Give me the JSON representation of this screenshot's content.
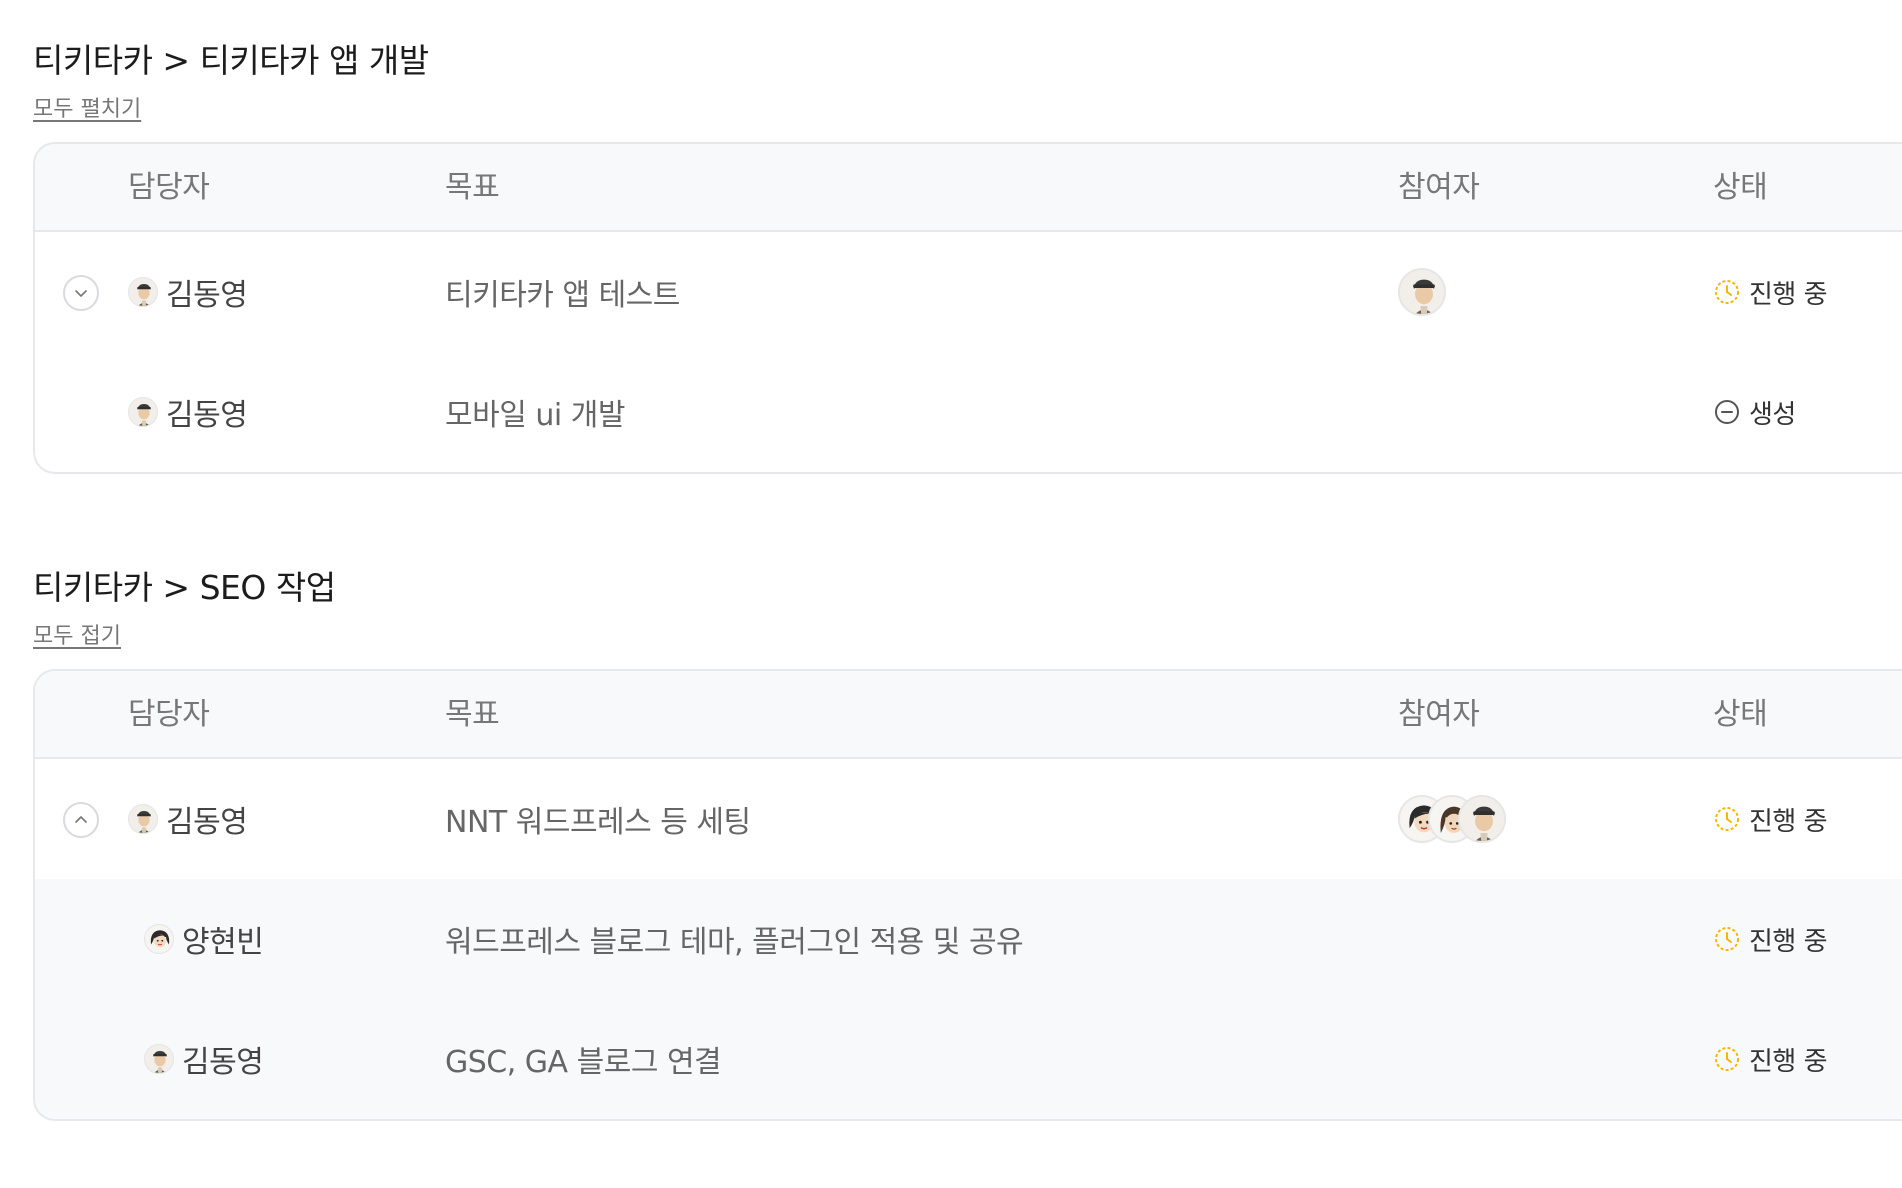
{
  "sections": [
    {
      "title": "티키타카 > 티키타카 앱 개발",
      "toggle_label": "모두 펼치기",
      "headers": {
        "owner": "담당자",
        "goal": "목표",
        "participants": "참여자",
        "status": "상태"
      },
      "rows": [
        {
          "owner": "김동영",
          "goal": "티키타카 앱  테스트",
          "status": "진행 중"
        },
        {
          "owner": "김동영",
          "goal": "모바일 ui 개발",
          "status": "생성"
        }
      ]
    },
    {
      "title": "티키타카 > SEO 작업",
      "toggle_label": "모두 접기",
      "headers": {
        "owner": "담당자",
        "goal": "목표",
        "participants": "참여자",
        "status": "상태"
      },
      "rows": [
        {
          "owner": "김동영",
          "goal": "NNT 워드프레스 등 세팅",
          "status": "진행 중"
        },
        {
          "owner": "양현빈",
          "goal": "워드프레스 블로그 테마, 플러그인 적용 및 공유",
          "status": "진행 중"
        },
        {
          "owner": "김동영",
          "goal": "GSC, GA 블로그 연결",
          "status": "진행 중"
        }
      ]
    }
  ],
  "colors": {
    "in_progress": "#f5b700",
    "created": "#555555",
    "row_shaded": "#f8f9fb",
    "border": "#e6e8ec"
  },
  "icons": {
    "expand": "chevron-down-icon",
    "collapse": "chevron-up-icon",
    "in_progress": "clock-icon",
    "created": "minus-circle-icon"
  }
}
